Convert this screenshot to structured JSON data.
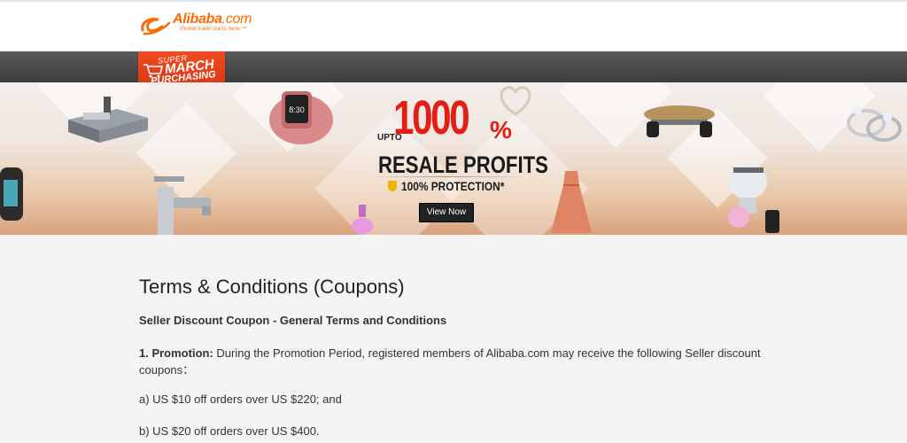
{
  "header": {
    "logo_name": "Alibaba",
    "logo_dot": ".com",
    "logo_tagline": "Global trade starts here.™"
  },
  "promo_badge": {
    "line1": "SUPER",
    "line2": "MARCH",
    "line3": "PURCHASING"
  },
  "banner": {
    "upto": "UPTO",
    "big_number": "1000",
    "percent": "%",
    "resale": "RESALE PROFITS",
    "protection": "100% PROTECTION*",
    "cta": "View Now",
    "products": [
      "laser-machine-icon",
      "smartwatch-icon",
      "heart-pendant-icon",
      "skateboard-icon",
      "rings-icon",
      "fitness-band-icon",
      "faucet-icon",
      "dress-icon",
      "speaker-bulb-icon",
      "nail-polish-icon"
    ]
  },
  "content": {
    "title": "Terms & Conditions (Coupons)",
    "subtitle": "Seller Discount Coupon - General Terms and Conditions",
    "p1_label": "1. Promotion:",
    "p1_text": " During the Promotion Period, registered members of Alibaba.com may receive the following Seller discount coupons：",
    "item_a": "a) US $10 off orders over US $220; and",
    "item_b": "b) US $20 off orders over US $400."
  },
  "colors": {
    "brand": "#ff6a00",
    "headline_red": "#e41e14",
    "dark_bar": "#444444"
  }
}
